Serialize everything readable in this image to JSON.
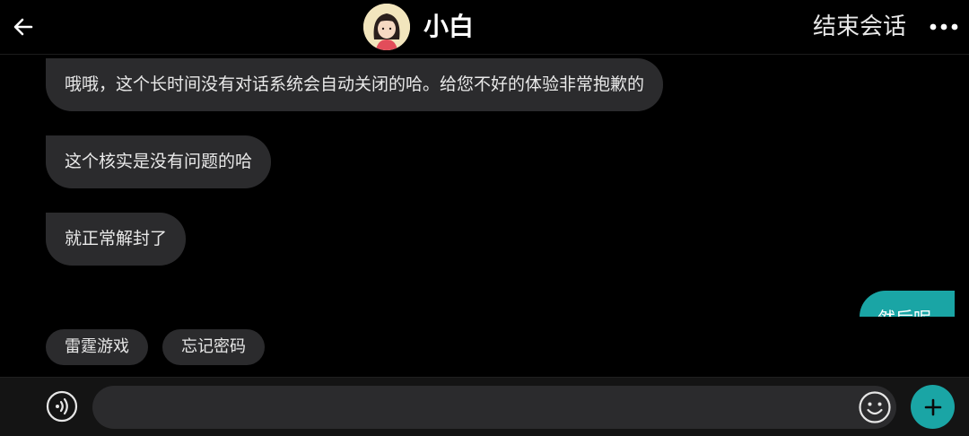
{
  "header": {
    "back_icon": "arrow-left-icon",
    "contact_name": "小白",
    "end_session_label": "结束会话",
    "more_icon": "more-horizontal-icon"
  },
  "messages": [
    {
      "direction": "incoming",
      "text": "哦哦，这个长时间没有对话系统会自动关闭的哈。给您不好的体验非常抱歉的"
    },
    {
      "direction": "incoming",
      "text": "这个核实是没有问题的哈"
    },
    {
      "direction": "incoming",
      "text": "就正常解封了"
    },
    {
      "direction": "outgoing",
      "text": "然后呢"
    }
  ],
  "quick_replies": [
    "雷霆游戏",
    "忘记密码"
  ],
  "composer": {
    "placeholder": "",
    "voice_icon": "voice-icon",
    "emoji_icon": "emoji-icon",
    "plus_icon": "plus-icon"
  },
  "colors": {
    "background": "#000000",
    "bubble_incoming": "#2b2b2d",
    "accent": "#1aa5a5"
  }
}
